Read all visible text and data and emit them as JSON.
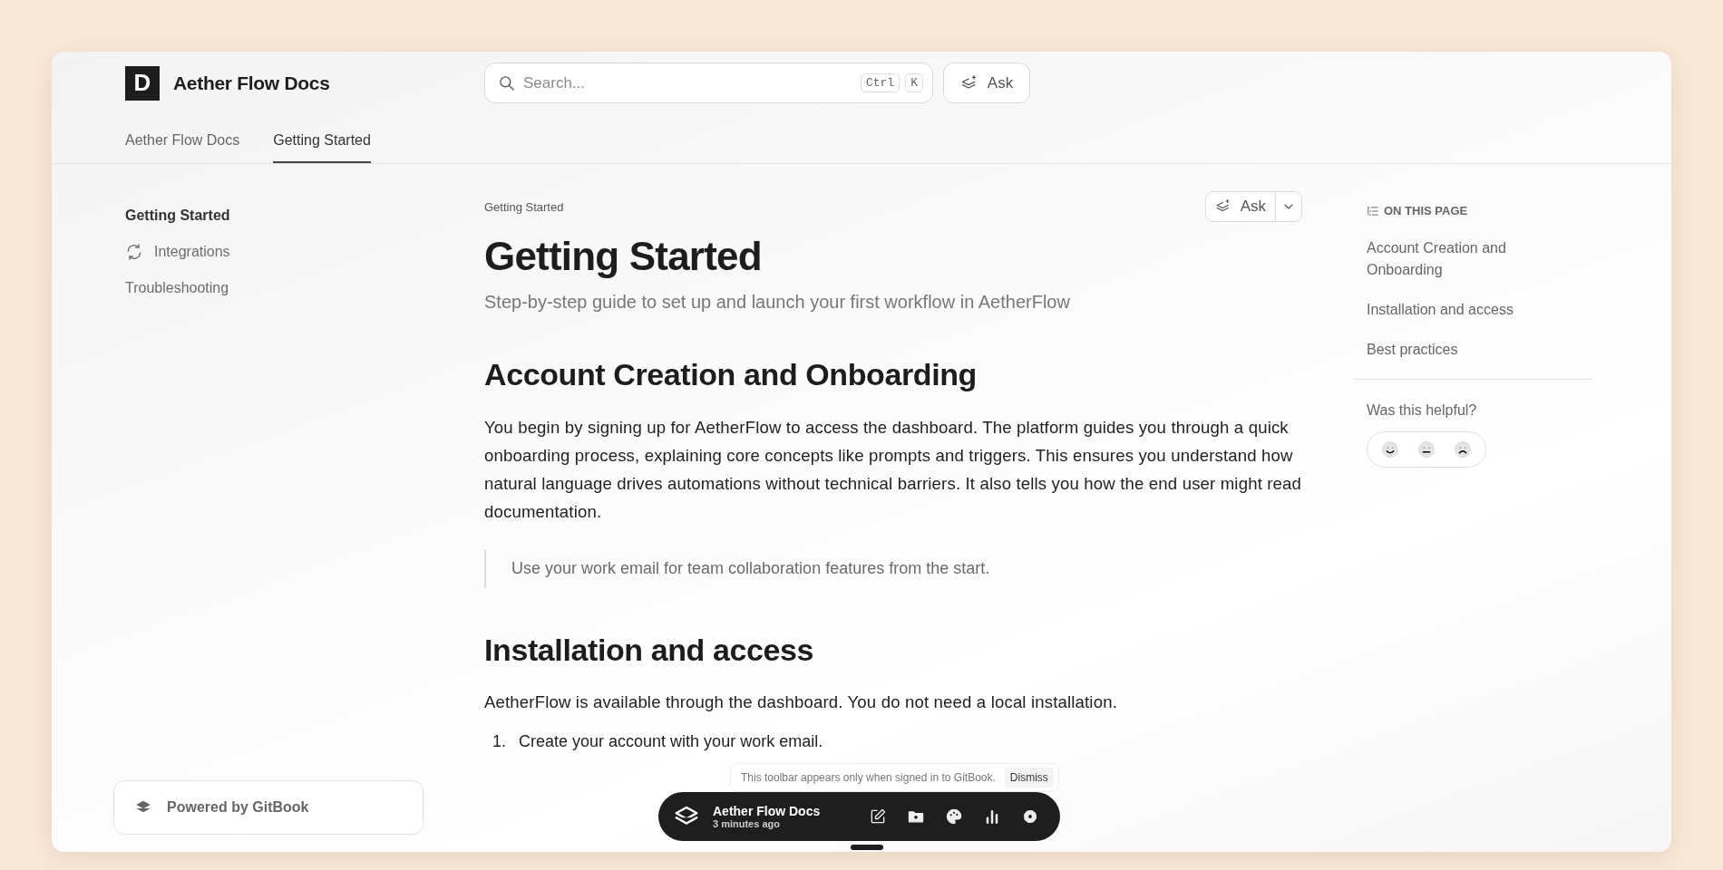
{
  "site": {
    "logo_letter": "D",
    "title": "Aether Flow Docs"
  },
  "search": {
    "placeholder": "Search...",
    "shortcut_keys": [
      "Ctrl",
      "K"
    ]
  },
  "ask_button": {
    "label": "Ask"
  },
  "tabs": [
    {
      "label": "Aether Flow Docs",
      "selected": false
    },
    {
      "label": "Getting Started",
      "selected": true
    }
  ],
  "sidebar": {
    "items": [
      {
        "kind": "plain",
        "label": "Getting Started",
        "selected": true
      },
      {
        "kind": "icon",
        "label": "Integrations",
        "selected": false
      },
      {
        "kind": "plain",
        "label": "Troubleshooting",
        "selected": false
      }
    ],
    "powered_by": "Powered by GitBook"
  },
  "page": {
    "breadcrumb": "Getting Started",
    "ask_button": "Ask",
    "title": "Getting Started",
    "description": "Step-by-step guide to set up and launch your first workflow in AetherFlow",
    "blocks": [
      {
        "kind": "heading",
        "text": "Account Creation and Onboarding"
      },
      {
        "kind": "paragraph",
        "text": "You begin by signing up for AetherFlow to access the dashboard. The platform guides you through a quick onboarding process, explaining core concepts like prompts and triggers. This ensures you understand how natural language drives automations without technical barriers. It also tells you how the end user might read documentation."
      },
      {
        "kind": "quote",
        "text": "Use your work email for team collaboration features from the start."
      },
      {
        "kind": "heading",
        "text": "Installation and access"
      },
      {
        "kind": "paragraph",
        "text": "AetherFlow is available through the dashboard. You do not need a local installation."
      },
      {
        "kind": "list_item",
        "number": "1.",
        "text": "Create your account with your work email."
      }
    ]
  },
  "toc": {
    "title": "ON THIS PAGE",
    "items": [
      "Account Creation and Onboarding",
      "Installation and access",
      "Best practices"
    ],
    "feedback_prompt": "Was this helpful?"
  },
  "toolbar": {
    "notice": "This toolbar appears only when signed in to GitBook.",
    "dismiss": "Dismiss",
    "site_name": "Aether Flow Docs",
    "updated": "3 minutes ago"
  }
}
